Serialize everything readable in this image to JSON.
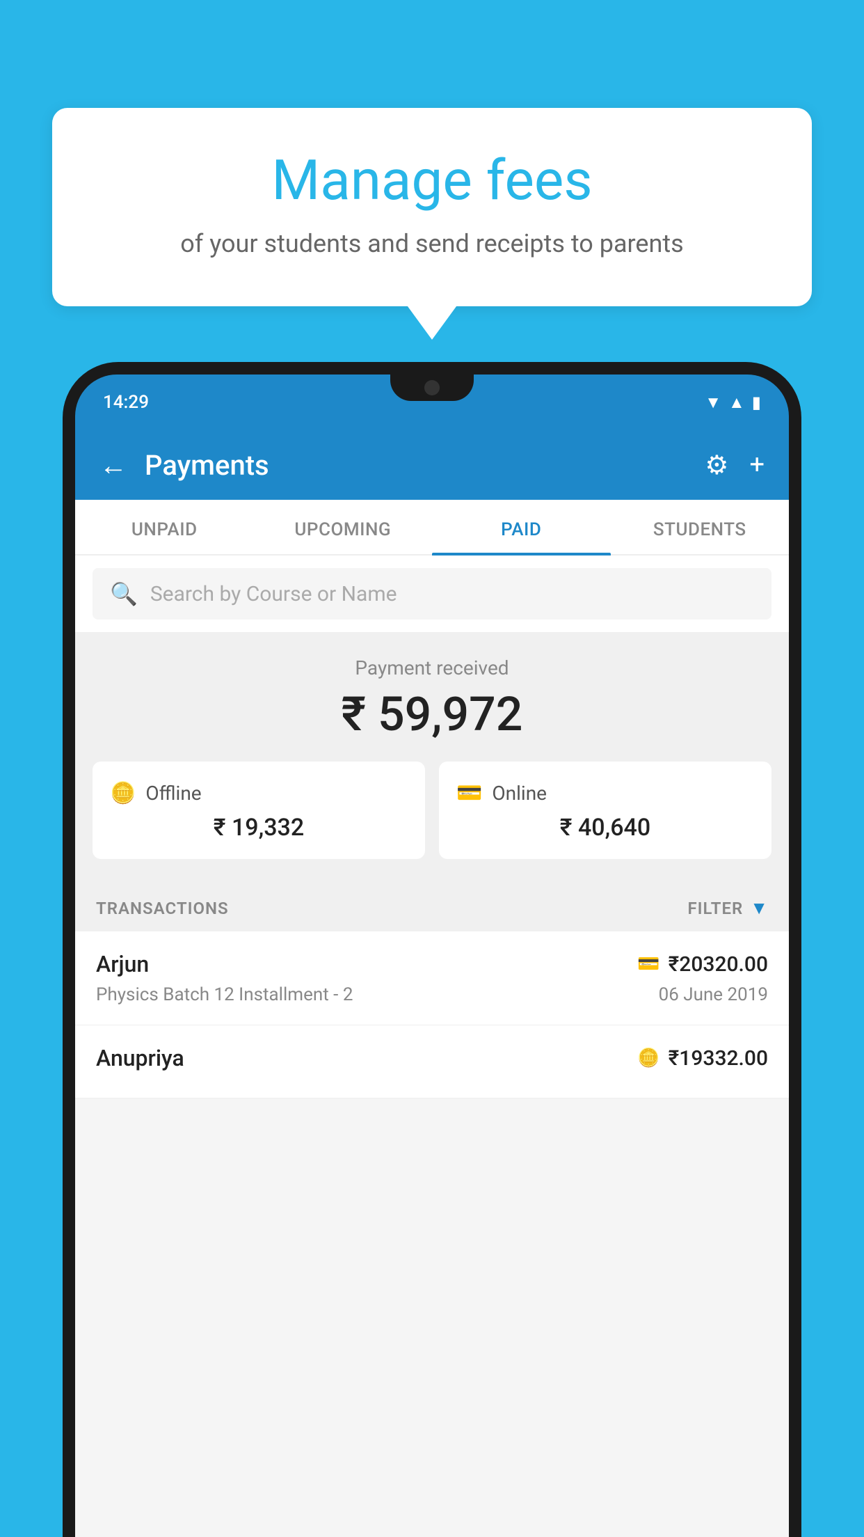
{
  "background": {
    "color": "#29b6e8"
  },
  "bubble": {
    "title": "Manage fees",
    "subtitle": "of your students and send receipts to parents"
  },
  "phone": {
    "status_bar": {
      "time": "14:29"
    },
    "app_bar": {
      "title": "Payments",
      "back_label": "←",
      "settings_icon": "⚙",
      "plus_icon": "+"
    },
    "tabs": [
      {
        "label": "UNPAID",
        "active": false
      },
      {
        "label": "UPCOMING",
        "active": false
      },
      {
        "label": "PAID",
        "active": true
      },
      {
        "label": "STUDENTS",
        "active": false
      }
    ],
    "search": {
      "placeholder": "Search by Course or Name"
    },
    "payment_summary": {
      "label": "Payment received",
      "amount": "₹ 59,972",
      "offline_label": "Offline",
      "offline_amount": "₹ 19,332",
      "online_label": "Online",
      "online_amount": "₹ 40,640"
    },
    "transactions": {
      "header_label": "TRANSACTIONS",
      "filter_label": "FILTER",
      "items": [
        {
          "name": "Arjun",
          "detail": "Physics Batch 12 Installment - 2",
          "amount": "₹20320.00",
          "date": "06 June 2019",
          "payment_type": "card"
        },
        {
          "name": "Anupriya",
          "detail": "",
          "amount": "₹19332.00",
          "date": "",
          "payment_type": "offline"
        }
      ]
    }
  }
}
